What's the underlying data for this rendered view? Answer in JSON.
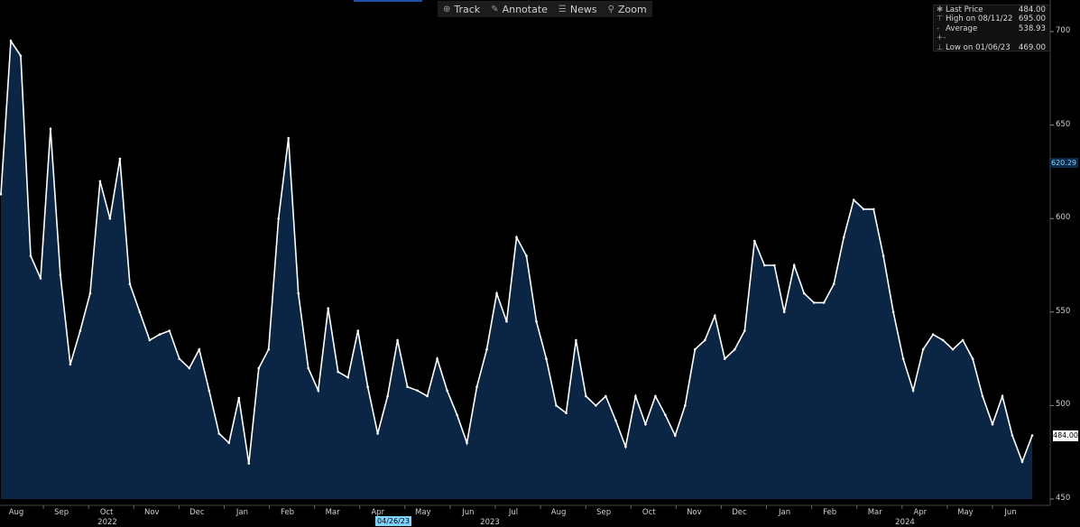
{
  "toolbar": {
    "items": [
      {
        "label": "Track",
        "icon": "crosshair-icon"
      },
      {
        "label": "Annotate",
        "icon": "pencil-icon"
      },
      {
        "label": "News",
        "icon": "news-icon"
      },
      {
        "label": "Zoom",
        "icon": "magnifier-icon"
      }
    ]
  },
  "legend": {
    "rows": [
      {
        "label": "Last Price",
        "value": "484.00"
      },
      {
        "label": "High on 08/11/22",
        "value": "695.00"
      },
      {
        "label": "Average",
        "value": "538.93"
      },
      {
        "label": "Low on 01/06/23",
        "value": "469.00"
      }
    ]
  },
  "tags": {
    "last_price": "484.00",
    "crosshair_value": "620.29",
    "crosshair_date": "04/26/23"
  },
  "colors": {
    "line": "#ffffff",
    "fill": "#0b2545",
    "background": "#000000"
  },
  "chart_data": {
    "type": "area",
    "ylim": [
      450,
      710
    ],
    "y_ticks": [
      450,
      500,
      550,
      600,
      650,
      700
    ],
    "y_tick_labels": [
      "450",
      "500",
      "550",
      "600",
      "650",
      "700"
    ],
    "x_month_labels": [
      "Aug",
      "Sep",
      "Oct",
      "Nov",
      "Dec",
      "Jan",
      "Feb",
      "Mar",
      "Apr",
      "May",
      "Jun",
      "Jul",
      "Aug",
      "Sep",
      "Oct",
      "Nov",
      "Dec",
      "Jan",
      "Feb",
      "Mar",
      "Apr",
      "May",
      "Jun"
    ],
    "x_year_labels": [
      "2022",
      "2023",
      "2024"
    ],
    "x_start": "2022-07-25",
    "x_end": "2024-06-21",
    "series": [
      {
        "values_weekly": [
          613,
          695,
          687,
          580,
          568,
          648,
          570,
          522,
          540,
          560,
          620,
          600,
          632,
          565,
          550,
          535,
          538,
          540,
          525,
          520,
          530,
          508,
          485,
          480,
          504,
          469,
          520,
          530,
          600,
          643,
          560,
          520,
          508,
          552,
          518,
          515,
          540,
          510,
          485,
          505,
          535,
          510,
          508,
          505,
          525,
          508,
          495,
          480,
          510,
          530,
          560,
          545,
          590,
          580,
          545,
          525,
          500,
          496,
          535,
          505,
          500,
          505,
          492,
          478,
          505,
          490,
          505,
          495,
          484,
          500,
          530,
          535,
          548,
          525,
          530,
          540,
          588,
          575,
          575,
          550,
          575,
          560,
          555,
          555,
          565,
          590,
          610,
          605,
          605,
          580,
          550,
          525,
          508,
          530,
          538,
          535,
          530,
          535,
          525,
          505,
          490,
          505,
          484,
          470,
          484
        ]
      }
    ]
  }
}
